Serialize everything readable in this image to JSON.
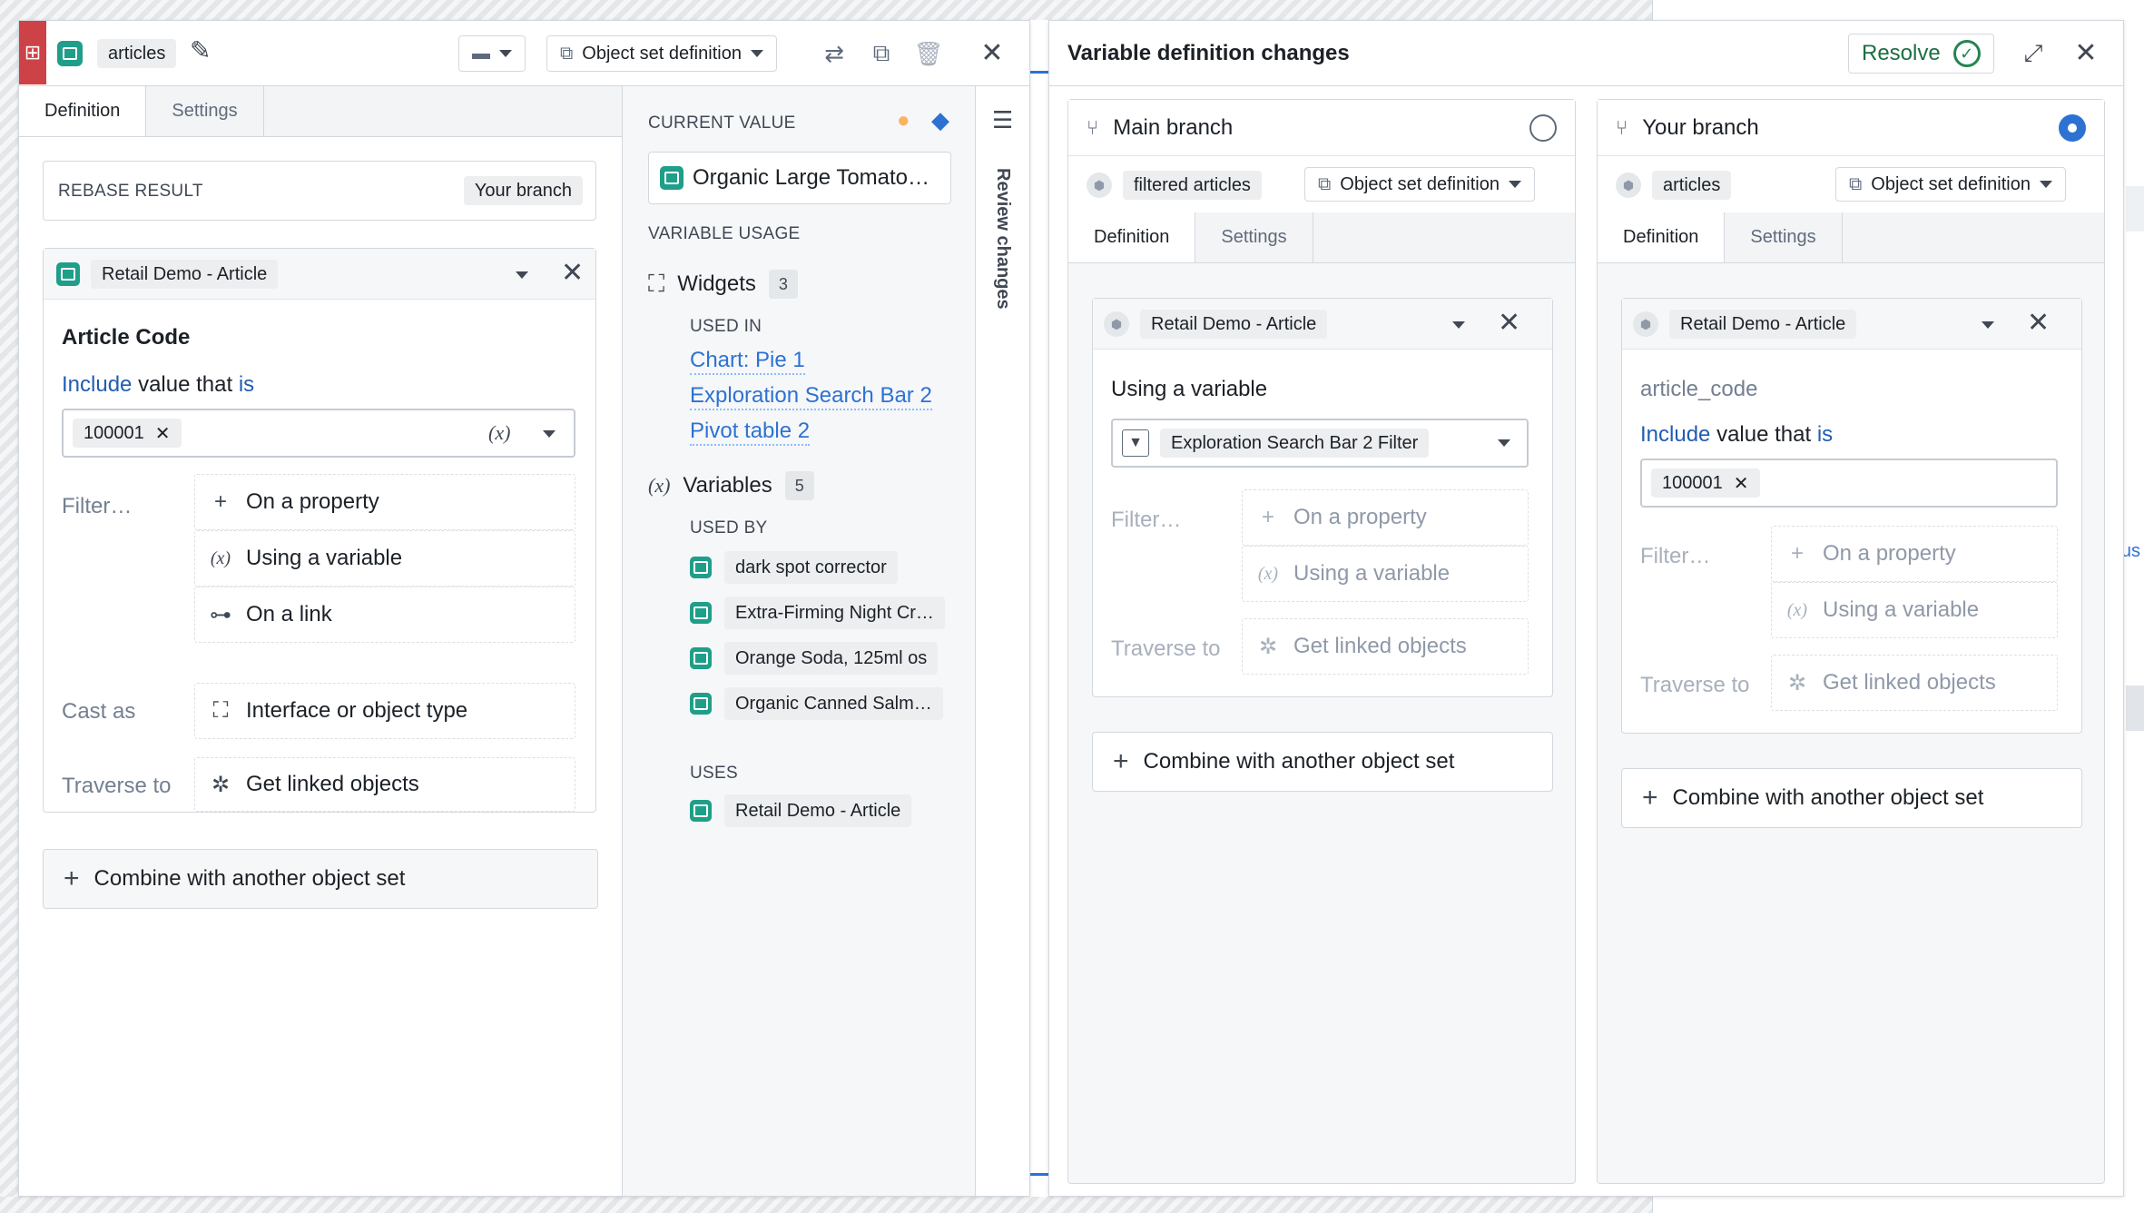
{
  "left_panel": {
    "object_name": "articles",
    "header_dropdown": "Object set definition",
    "tabs": [
      "Definition",
      "Settings"
    ],
    "rebase_label": "REBASE RESULT",
    "rebase_branch": "Your branch",
    "object_type": "Retail Demo - Article",
    "property_title": "Article Code",
    "filter_include": "Include",
    "filter_value_that": "value that",
    "filter_is": "is",
    "value_chip": "100001",
    "var_symbol": "(x)",
    "filter_label": "Filter…",
    "filter_options": [
      "On a property",
      "Using a variable",
      "On a link"
    ],
    "cast_label": "Cast as",
    "cast_option": "Interface or object type",
    "traverse_label": "Traverse to",
    "traverse_option": "Get linked objects",
    "combine": "Combine with another object set"
  },
  "middle": {
    "current_value_label": "CURRENT VALUE",
    "current_value": "Organic Large Tomato…",
    "variable_usage_label": "VARIABLE USAGE",
    "widgets_label": "Widgets",
    "widgets_count": "3",
    "used_in_label": "USED IN",
    "used_in": [
      "Chart: Pie 1",
      "Exploration Search Bar 2",
      "Pivot table 2"
    ],
    "variables_label": "Variables",
    "variables_count": "5",
    "used_by_label": "USED BY",
    "used_by": [
      "dark spot corrector",
      "Extra-Firming Night Cr…",
      "Orange Soda, 125ml os",
      "Organic Canned Salm…"
    ],
    "uses_label": "USES",
    "uses": [
      "Retail Demo - Article"
    ],
    "review_changes": "Review changes"
  },
  "right_panel": {
    "title": "Variable definition changes",
    "resolve": "Resolve",
    "main_branch": {
      "name": "Main branch",
      "object": "filtered articles",
      "dropdown": "Object set definition",
      "tabs": [
        "Definition",
        "Settings"
      ],
      "object_type": "Retail Demo - Article",
      "using_variable_label": "Using a variable",
      "variable_select": "Exploration Search Bar 2 Filter",
      "filter_label": "Filter…",
      "filter_options": [
        "On a property",
        "Using a variable"
      ],
      "traverse_label": "Traverse to",
      "traverse_option": "Get linked objects",
      "combine": "Combine with another object set"
    },
    "your_branch": {
      "name": "Your branch",
      "object": "articles",
      "dropdown": "Object set definition",
      "tabs": [
        "Definition",
        "Settings"
      ],
      "object_type": "Retail Demo - Article",
      "property": "article_code",
      "filter_include": "Include",
      "filter_value_that": "value that",
      "filter_is": "is",
      "value_chip": "100001",
      "filter_label": "Filter…",
      "filter_options": [
        "On a property",
        "Using a variable"
      ],
      "traverse_label": "Traverse to",
      "traverse_option": "Get linked objects",
      "combine": "Combine with another object set"
    }
  },
  "background": {
    "peek_text": "us"
  }
}
